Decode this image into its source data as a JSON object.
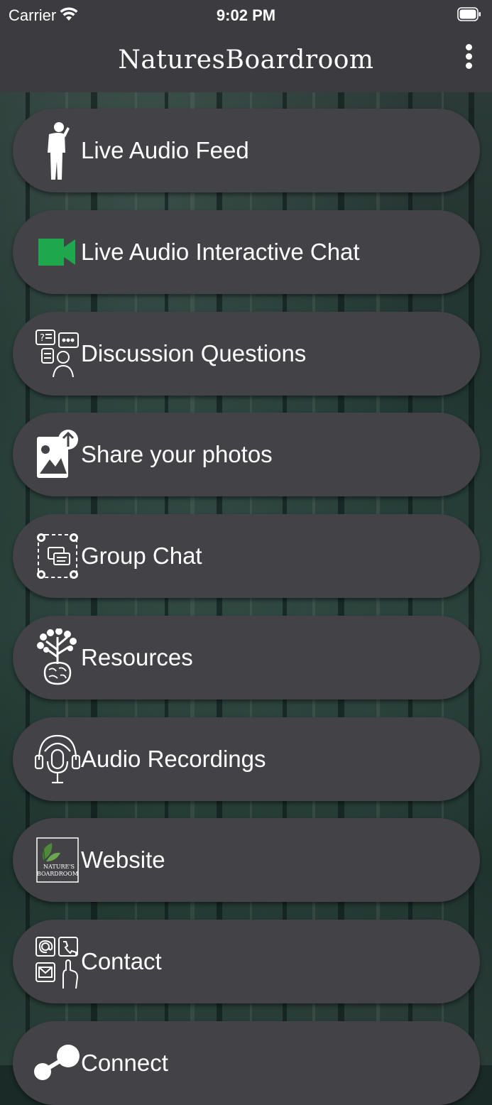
{
  "status_bar": {
    "carrier": "Carrier",
    "time": "9:02 PM"
  },
  "app": {
    "title": "NaturesBoardroom"
  },
  "menu": {
    "items": [
      {
        "label": "Live Audio Feed",
        "icon": "person-speaking-icon"
      },
      {
        "label": "Live Audio Interactive Chat",
        "icon": "video-camera-icon"
      },
      {
        "label": "Discussion Questions",
        "icon": "discussion-icon"
      },
      {
        "label": "Share your photos",
        "icon": "photo-upload-icon"
      },
      {
        "label": "Group Chat",
        "icon": "group-chat-icon"
      },
      {
        "label": "Resources",
        "icon": "tree-brain-icon"
      },
      {
        "label": "Audio Recordings",
        "icon": "podcast-mic-icon"
      },
      {
        "label": "Website",
        "icon": "natures-boardroom-logo-icon",
        "logo_text": "Nature's Boardroom"
      },
      {
        "label": "Contact",
        "icon": "contact-icon"
      },
      {
        "label": "Connect",
        "icon": "share-icon"
      }
    ]
  },
  "colors": {
    "bar": "#3c3c40",
    "item": "#434247",
    "video_icon": "#1fa84b"
  }
}
